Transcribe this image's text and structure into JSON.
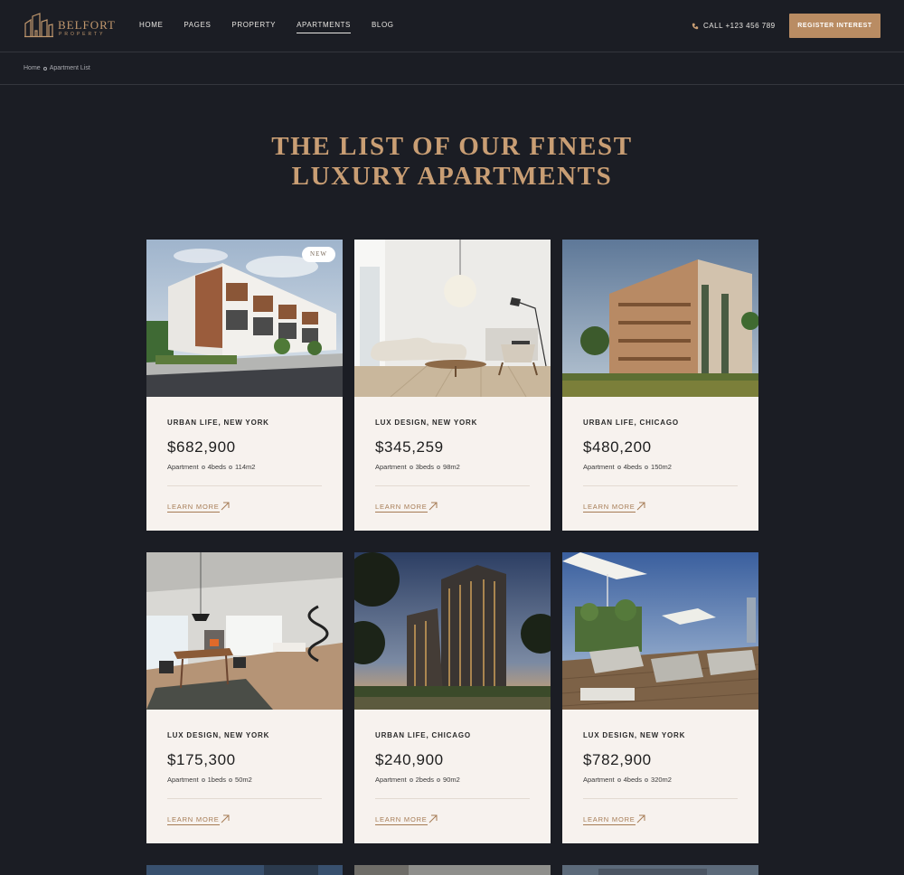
{
  "header": {
    "logo_name": "BELFORT",
    "logo_sub": "PROPERTY",
    "nav": [
      "HOME",
      "PAGES",
      "PROPERTY",
      "APARTMENTS",
      "BLOG"
    ],
    "nav_active": "APARTMENTS",
    "call": "CALL +123 456 789",
    "register": "REGISTER INTEREST"
  },
  "breadcrumb": {
    "home": "Home",
    "current": "Apartment List"
  },
  "heading": {
    "line1": "THE LIST OF OUR FINEST",
    "line2": "LUXURY APARTMENTS"
  },
  "colors": {
    "background": "#1b1d24",
    "accent": "#c99e74",
    "button": "#b98c63",
    "card": "#f7f2ee"
  },
  "listings": [
    {
      "badge": "NEW",
      "location": "URBAN LIFE, NEW YORK",
      "price": "$682,900",
      "type": "Apartment",
      "beds": "4beds",
      "area": "114m2",
      "cta": "LEARN MORE",
      "image": "modern-townhouse-exterior"
    },
    {
      "badge": "",
      "location": "LUX DESIGN, NEW YORK",
      "price": "$345,259",
      "type": "Apartment",
      "beds": "3beds",
      "area": "98m2",
      "cta": "LEARN MORE",
      "image": "white-living-room"
    },
    {
      "badge": "",
      "location": "URBAN LIFE, CHICAGO",
      "price": "$480,200",
      "type": "Apartment",
      "beds": "4beds",
      "area": "150m2",
      "cta": "LEARN MORE",
      "image": "wooden-apartment-block"
    },
    {
      "badge": "",
      "location": "LUX DESIGN, NEW YORK",
      "price": "$175,300",
      "type": "Apartment",
      "beds": "1beds",
      "area": "50m2",
      "cta": "LEARN MORE",
      "image": "dining-room-spiral-stair"
    },
    {
      "badge": "",
      "location": "URBAN LIFE, CHICAGO",
      "price": "$240,900",
      "type": "Apartment",
      "beds": "2beds",
      "area": "90m2",
      "cta": "LEARN MORE",
      "image": "high-rise-towers-dusk"
    },
    {
      "badge": "",
      "location": "LUX DESIGN, NEW YORK",
      "price": "$782,900",
      "type": "Apartment",
      "beds": "4beds",
      "area": "320m2",
      "cta": "LEARN MORE",
      "image": "rooftop-terrace"
    }
  ]
}
